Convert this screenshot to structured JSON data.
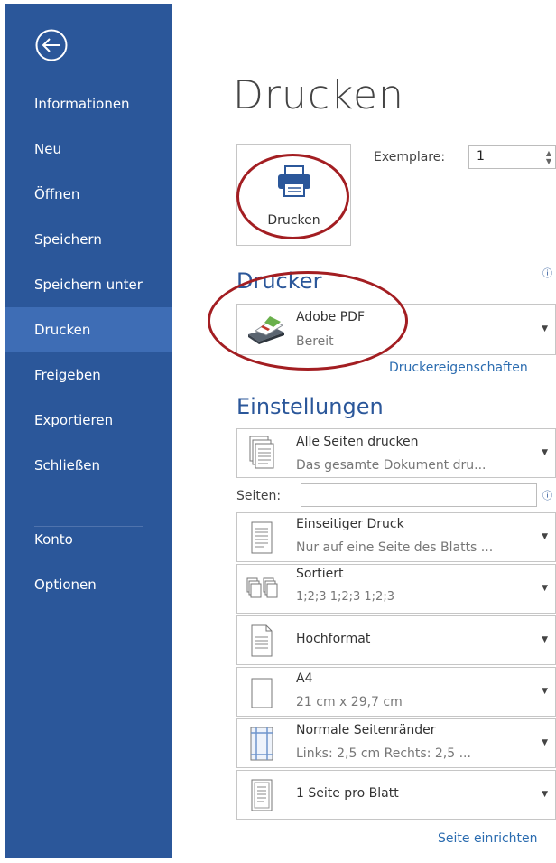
{
  "sidebar": {
    "items": [
      {
        "label": "Informationen"
      },
      {
        "label": "Neu"
      },
      {
        "label": "Öffnen"
      },
      {
        "label": "Speichern"
      },
      {
        "label": "Speichern unter"
      },
      {
        "label": "Drucken"
      },
      {
        "label": "Freigeben"
      },
      {
        "label": "Exportieren"
      },
      {
        "label": "Schließen"
      },
      {
        "label": "Konto"
      },
      {
        "label": "Optionen"
      }
    ],
    "active_item": "Drucken",
    "back_icon": "back-arrow-icon"
  },
  "main": {
    "title": "Drucken",
    "print_button_label": "Drucken",
    "copies": {
      "label": "Exemplare:",
      "value": "1"
    },
    "printer": {
      "heading": "Drucker",
      "name": "Adobe PDF",
      "status": "Bereit",
      "properties_link": "Druckereigenschaften"
    },
    "settings": {
      "heading": "Einstellungen",
      "print_range": {
        "title": "Alle Seiten drucken",
        "subtitle": "Das gesamte Dokument dru..."
      },
      "pages_label": "Seiten:",
      "pages_value": "",
      "sides": {
        "title": "Einseitiger Druck",
        "subtitle": "Nur auf eine Seite des Blatts ..."
      },
      "collation": {
        "title": "Sortiert",
        "subtitle": "1;2;3    1;2;3    1;2;3"
      },
      "orientation": {
        "title": "Hochformat"
      },
      "paper_size": {
        "title": "A4",
        "subtitle": "21 cm x 29,7 cm"
      },
      "margins": {
        "title": "Normale Seitenränder",
        "subtitle": "Links: 2,5 cm    Rechts: 2,5 ..."
      },
      "pages_per_sheet": {
        "title": "1 Seite pro Blatt"
      },
      "page_setup_link": "Seite einrichten"
    }
  },
  "colors": {
    "sidebar_bg": "#2b579a",
    "sidebar_active": "#3e6db5",
    "accent": "#2b579a",
    "annotation_red": "#a31e22"
  }
}
